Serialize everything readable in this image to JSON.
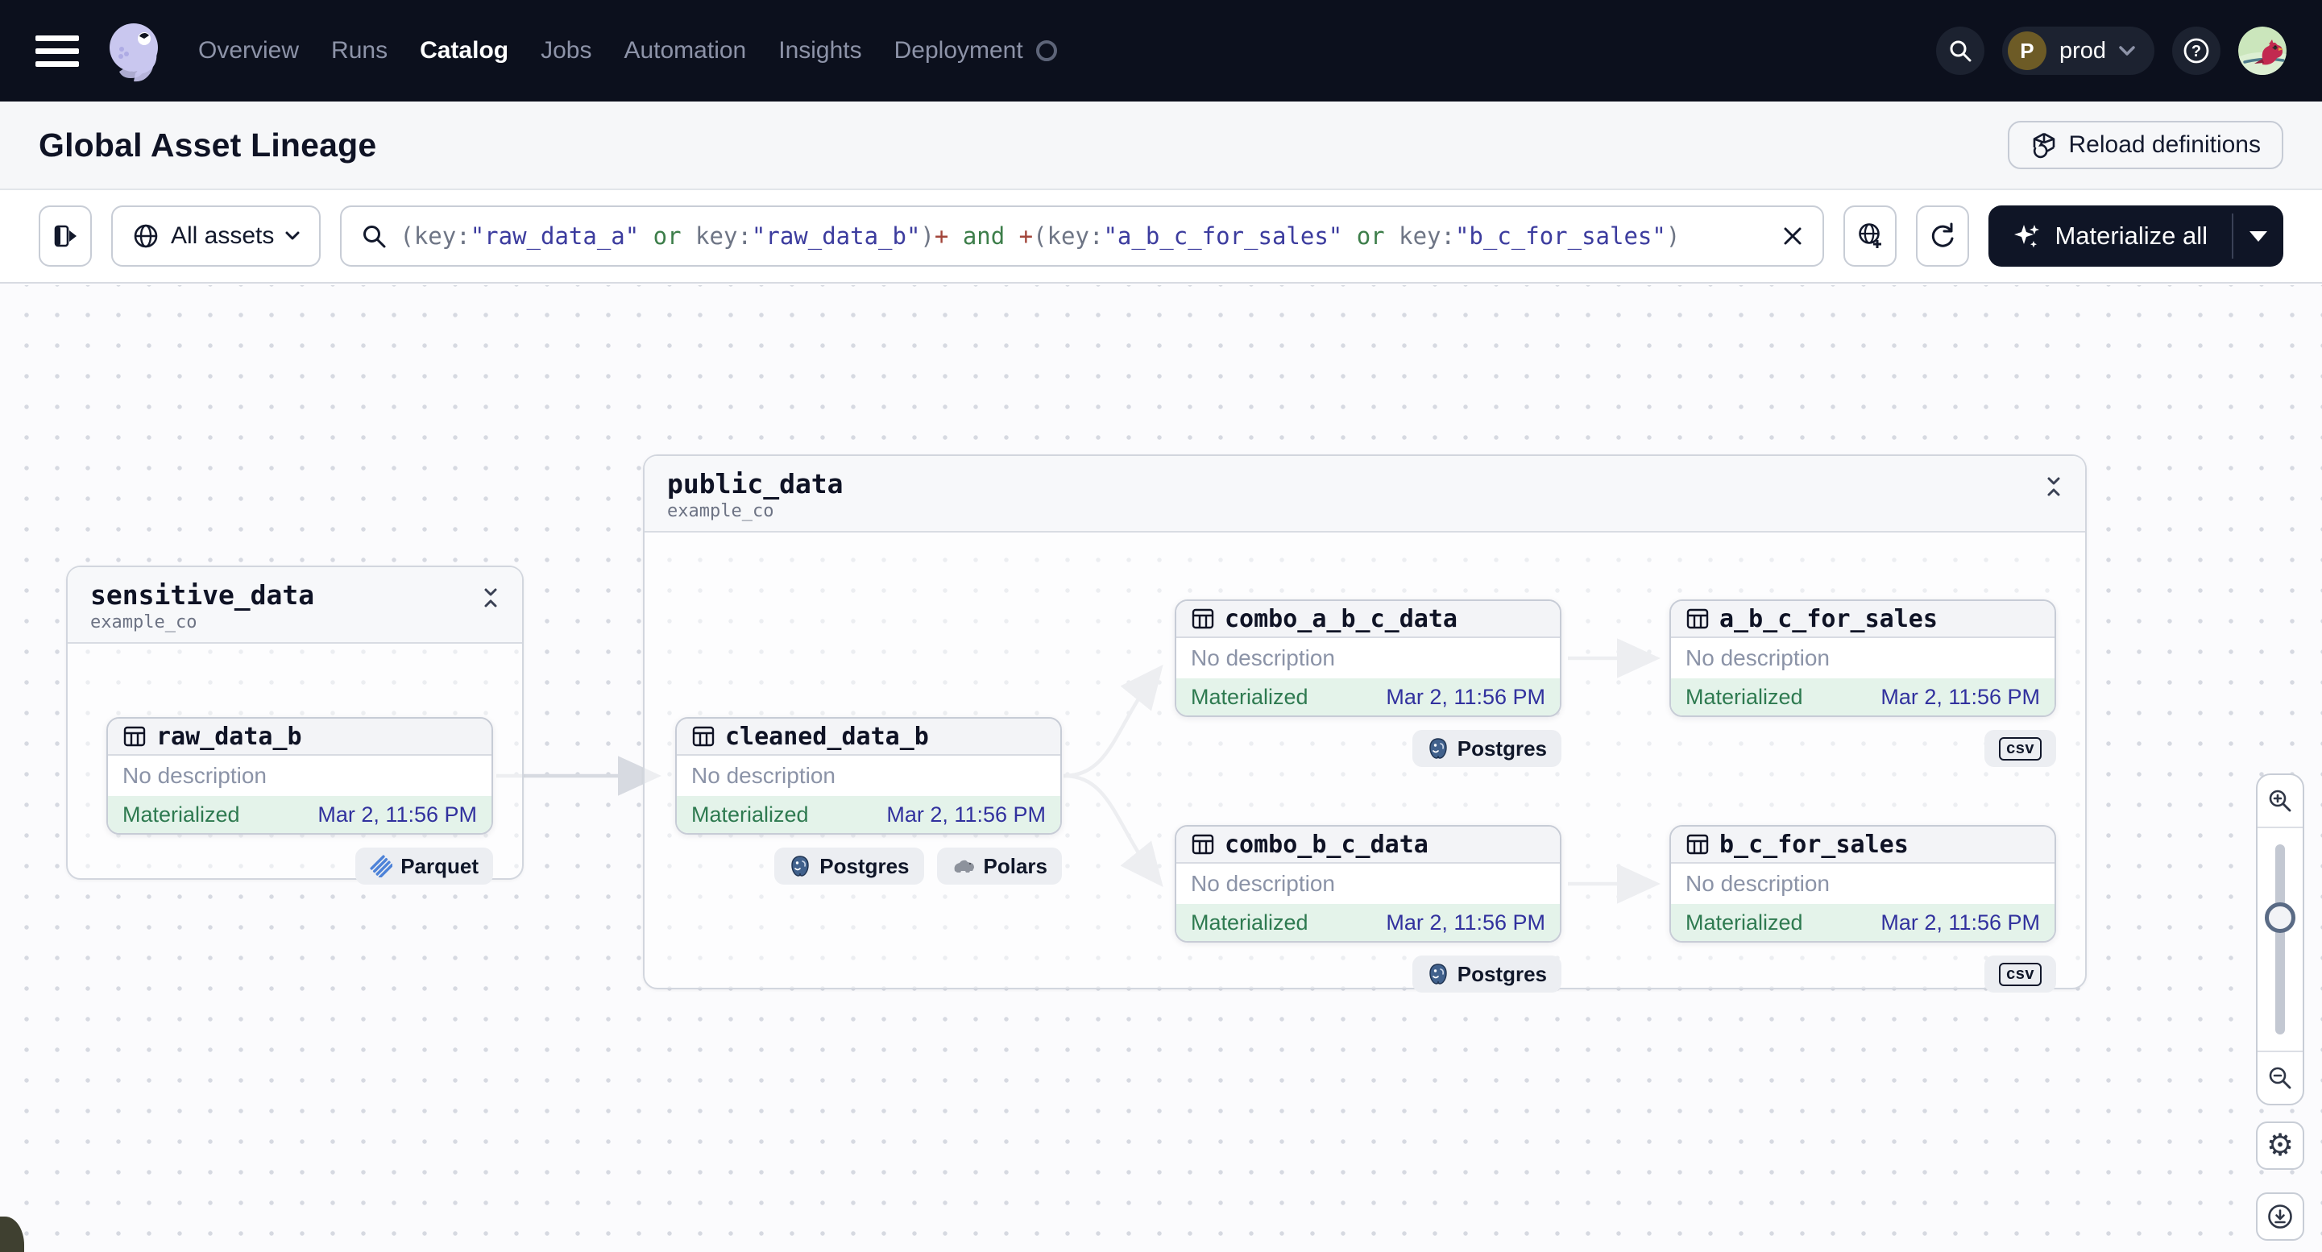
{
  "nav": {
    "items": [
      {
        "label": "Overview",
        "active": false
      },
      {
        "label": "Runs",
        "active": false
      },
      {
        "label": "Catalog",
        "active": true
      },
      {
        "label": "Jobs",
        "active": false
      },
      {
        "label": "Automation",
        "active": false
      },
      {
        "label": "Insights",
        "active": false
      },
      {
        "label": "Deployment",
        "active": false
      }
    ],
    "deployment_loading": true,
    "environment": {
      "initial": "P",
      "name": "prod"
    }
  },
  "header": {
    "title": "Global Asset Lineage",
    "reload_label": "Reload definitions"
  },
  "toolbar": {
    "scope_label": "All assets",
    "materialize_label": "Materialize all",
    "query": {
      "full_text": "(key:\"raw_data_a\" or key:\"raw_data_b\")+ and +(key:\"a_b_c_for_sales\" or key:\"b_c_for_sales\")",
      "segments": [
        {
          "t": "(key:",
          "c": "p"
        },
        {
          "t": "\"raw_data_a\"",
          "c": "s"
        },
        {
          "t": " or ",
          "c": "o"
        },
        {
          "t": "key:",
          "c": "p"
        },
        {
          "t": "\"raw_data_b\"",
          "c": "s"
        },
        {
          "t": ")",
          "c": "p"
        },
        {
          "t": "+",
          "c": "m"
        },
        {
          "t": " and ",
          "c": "o"
        },
        {
          "t": "+",
          "c": "m"
        },
        {
          "t": "(key:",
          "c": "p"
        },
        {
          "t": "\"a_b_c_for_sales\"",
          "c": "s"
        },
        {
          "t": " or ",
          "c": "o"
        },
        {
          "t": "key:",
          "c": "p"
        },
        {
          "t": "\"b_c_for_sales\"",
          "c": "s"
        },
        {
          "t": ")",
          "c": "p"
        }
      ]
    }
  },
  "graph": {
    "groups": [
      {
        "name": "sensitive_data",
        "subtitle": "example_co"
      },
      {
        "name": "public_data",
        "subtitle": "example_co"
      }
    ],
    "assets": [
      {
        "label": "raw_data_b",
        "description": "No description",
        "status": "Materialized",
        "timestamp": "Mar 2, 11:56 PM",
        "badges": [
          "Parquet"
        ]
      },
      {
        "label": "cleaned_data_b",
        "description": "No description",
        "status": "Materialized",
        "timestamp": "Mar 2, 11:56 PM",
        "badges": [
          "Postgres",
          "Polars"
        ]
      },
      {
        "label": "combo_a_b_c_data",
        "description": "No description",
        "status": "Materialized",
        "timestamp": "Mar 2, 11:56 PM",
        "badges": [
          "Postgres"
        ]
      },
      {
        "label": "a_b_c_for_sales",
        "description": "No description",
        "status": "Materialized",
        "timestamp": "Mar 2, 11:56 PM",
        "badges": [
          "csv"
        ]
      },
      {
        "label": "combo_b_c_data",
        "description": "No description",
        "status": "Materialized",
        "timestamp": "Mar 2, 11:56 PM",
        "badges": [
          "Postgres"
        ]
      },
      {
        "label": "b_c_for_sales",
        "description": "No description",
        "status": "Materialized",
        "timestamp": "Mar 2, 11:56 PM",
        "badges": [
          "csv"
        ]
      }
    ]
  },
  "icons": {
    "gear": "⚙"
  },
  "colors": {
    "nav_bg": "#0c101d",
    "materialize_bg": "#0f1526",
    "status_green_bg": "#e4f3ea",
    "status_green_text": "#2e7a50",
    "timestamp_indigo": "#31319e",
    "query_string": "#3c3c9e",
    "query_operator": "#3d7e4a",
    "query_modifier": "#a2453a",
    "edge_gray": "#d7dae1"
  }
}
